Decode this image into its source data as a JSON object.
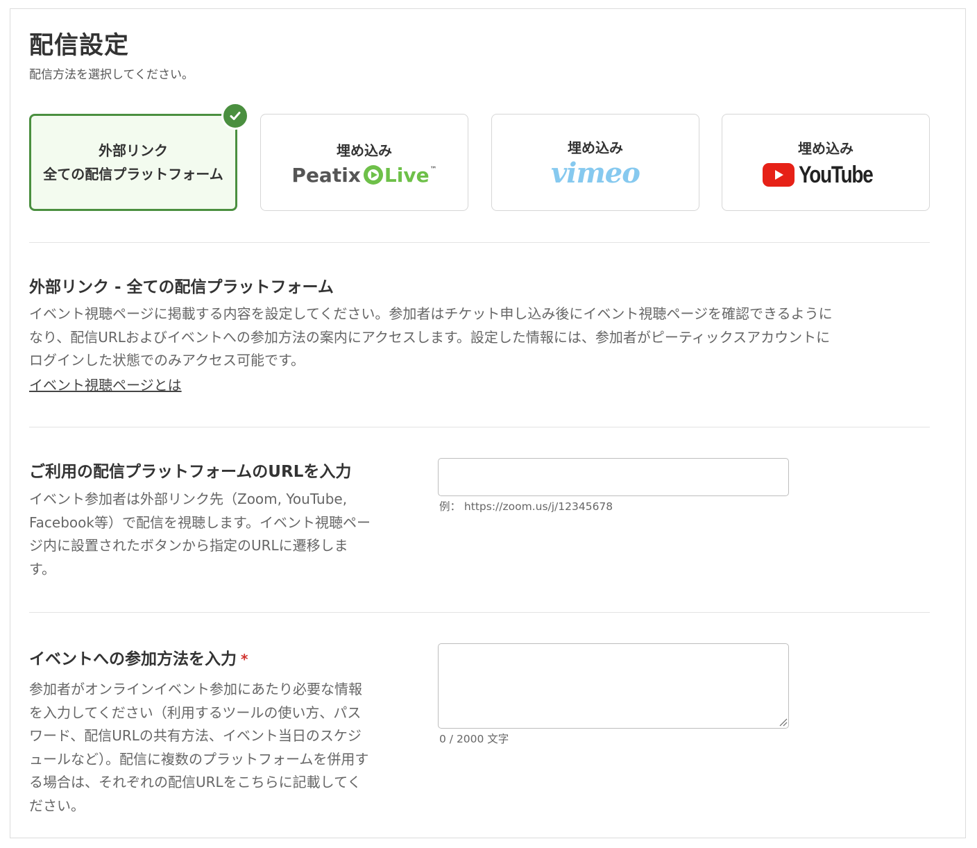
{
  "header": {
    "title": "配信設定",
    "subtitle": "配信方法を選択してください。"
  },
  "options": [
    {
      "line1": "外部リンク",
      "line2": "全ての配信プラットフォーム",
      "selected": true
    },
    {
      "line1": "埋め込み",
      "logo_text": "Peatix",
      "logo_text2": "Live",
      "logo_tm": "™",
      "logo": "peatix-live-logo"
    },
    {
      "line1": "埋め込み",
      "logo_text": "vimeo",
      "logo": "vimeo-logo"
    },
    {
      "line1": "埋め込み",
      "logo_text": "YouTube",
      "logo": "youtube-logo"
    }
  ],
  "section": {
    "heading": "外部リンク - 全ての配信プラットフォーム",
    "description_lines": [
      "イベント視聴ページに掲載する内容を設定してください。参加者はチケット申し込み後にイベント視聴ページを確認できるように",
      "なり、配信URLおよびイベントへの参加方法の案内にアクセスします。設定した情報には、参加者がピーティックスアカウントに",
      "ログインした状態でのみアクセス可能です。"
    ],
    "link": "イベント視聴ページとは"
  },
  "url_field": {
    "label": "ご利用の配信プラットフォームのURLを入力",
    "description_lines": [
      "イベント参加者は外部リンク先（Zoom, YouTube,",
      "Facebook等）で配信を視聴します。イベント視聴ペー",
      "ジ内に設置されたボタンから指定のURLに遷移しま",
      "す。"
    ],
    "value": "",
    "hint": "例： https://zoom.us/j/12345678"
  },
  "join_field": {
    "label": "イベントへの参加方法を入力",
    "required_mark": "*",
    "description_lines": [
      "参加者がオンラインイベント参加にあたり必要な情報",
      "を入力してください（利用するツールの使い方、パス",
      "ワード、配信URLの共有方法、イベント当日のスケジ",
      "ュールなど）。配信に複数のプラットフォームを併用す",
      "る場合は、それぞれの配信URLをこちらに記載してく",
      "ださい。"
    ],
    "value": "",
    "counter": "0 / 2000 文字"
  },
  "colors": {
    "accent_green": "#4a8f3f",
    "selected_bg": "#f3fbef",
    "required_red": "#d0312d",
    "youtube_red": "#e62117",
    "vimeo_blue": "#86c9ef",
    "peatix_green": "#6ec049"
  }
}
